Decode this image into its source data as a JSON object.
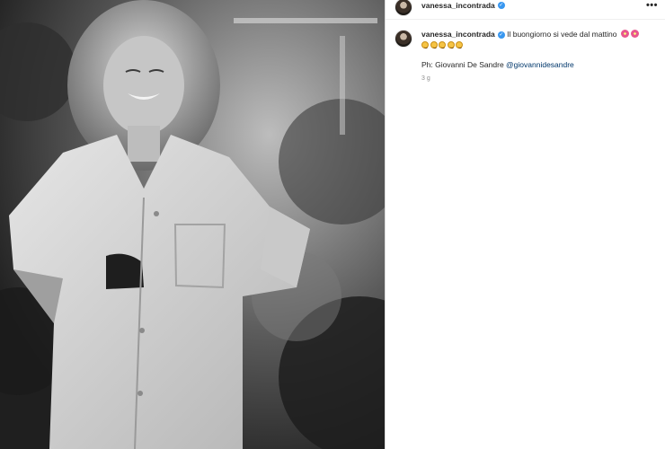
{
  "post": {
    "username": "vanessa_incontrada",
    "caption_text": "Il buongiorno si vede dal mattino",
    "caption_emojis_flowers": [
      "flower",
      "flower"
    ],
    "caption_emojis_smiles": [
      "smile",
      "smile",
      "smile",
      "smile",
      "smile"
    ],
    "credit_prefix": "Ph: Giovanni De Sandre",
    "credit_mention": "@giovannidesandre",
    "timestamp": "3 g"
  },
  "icons": {
    "verified": "verified-badge-icon",
    "more": "more-options-icon"
  },
  "colors": {
    "verified": "#3897f0",
    "mention": "#00376b",
    "muted": "#8e8e8e"
  }
}
